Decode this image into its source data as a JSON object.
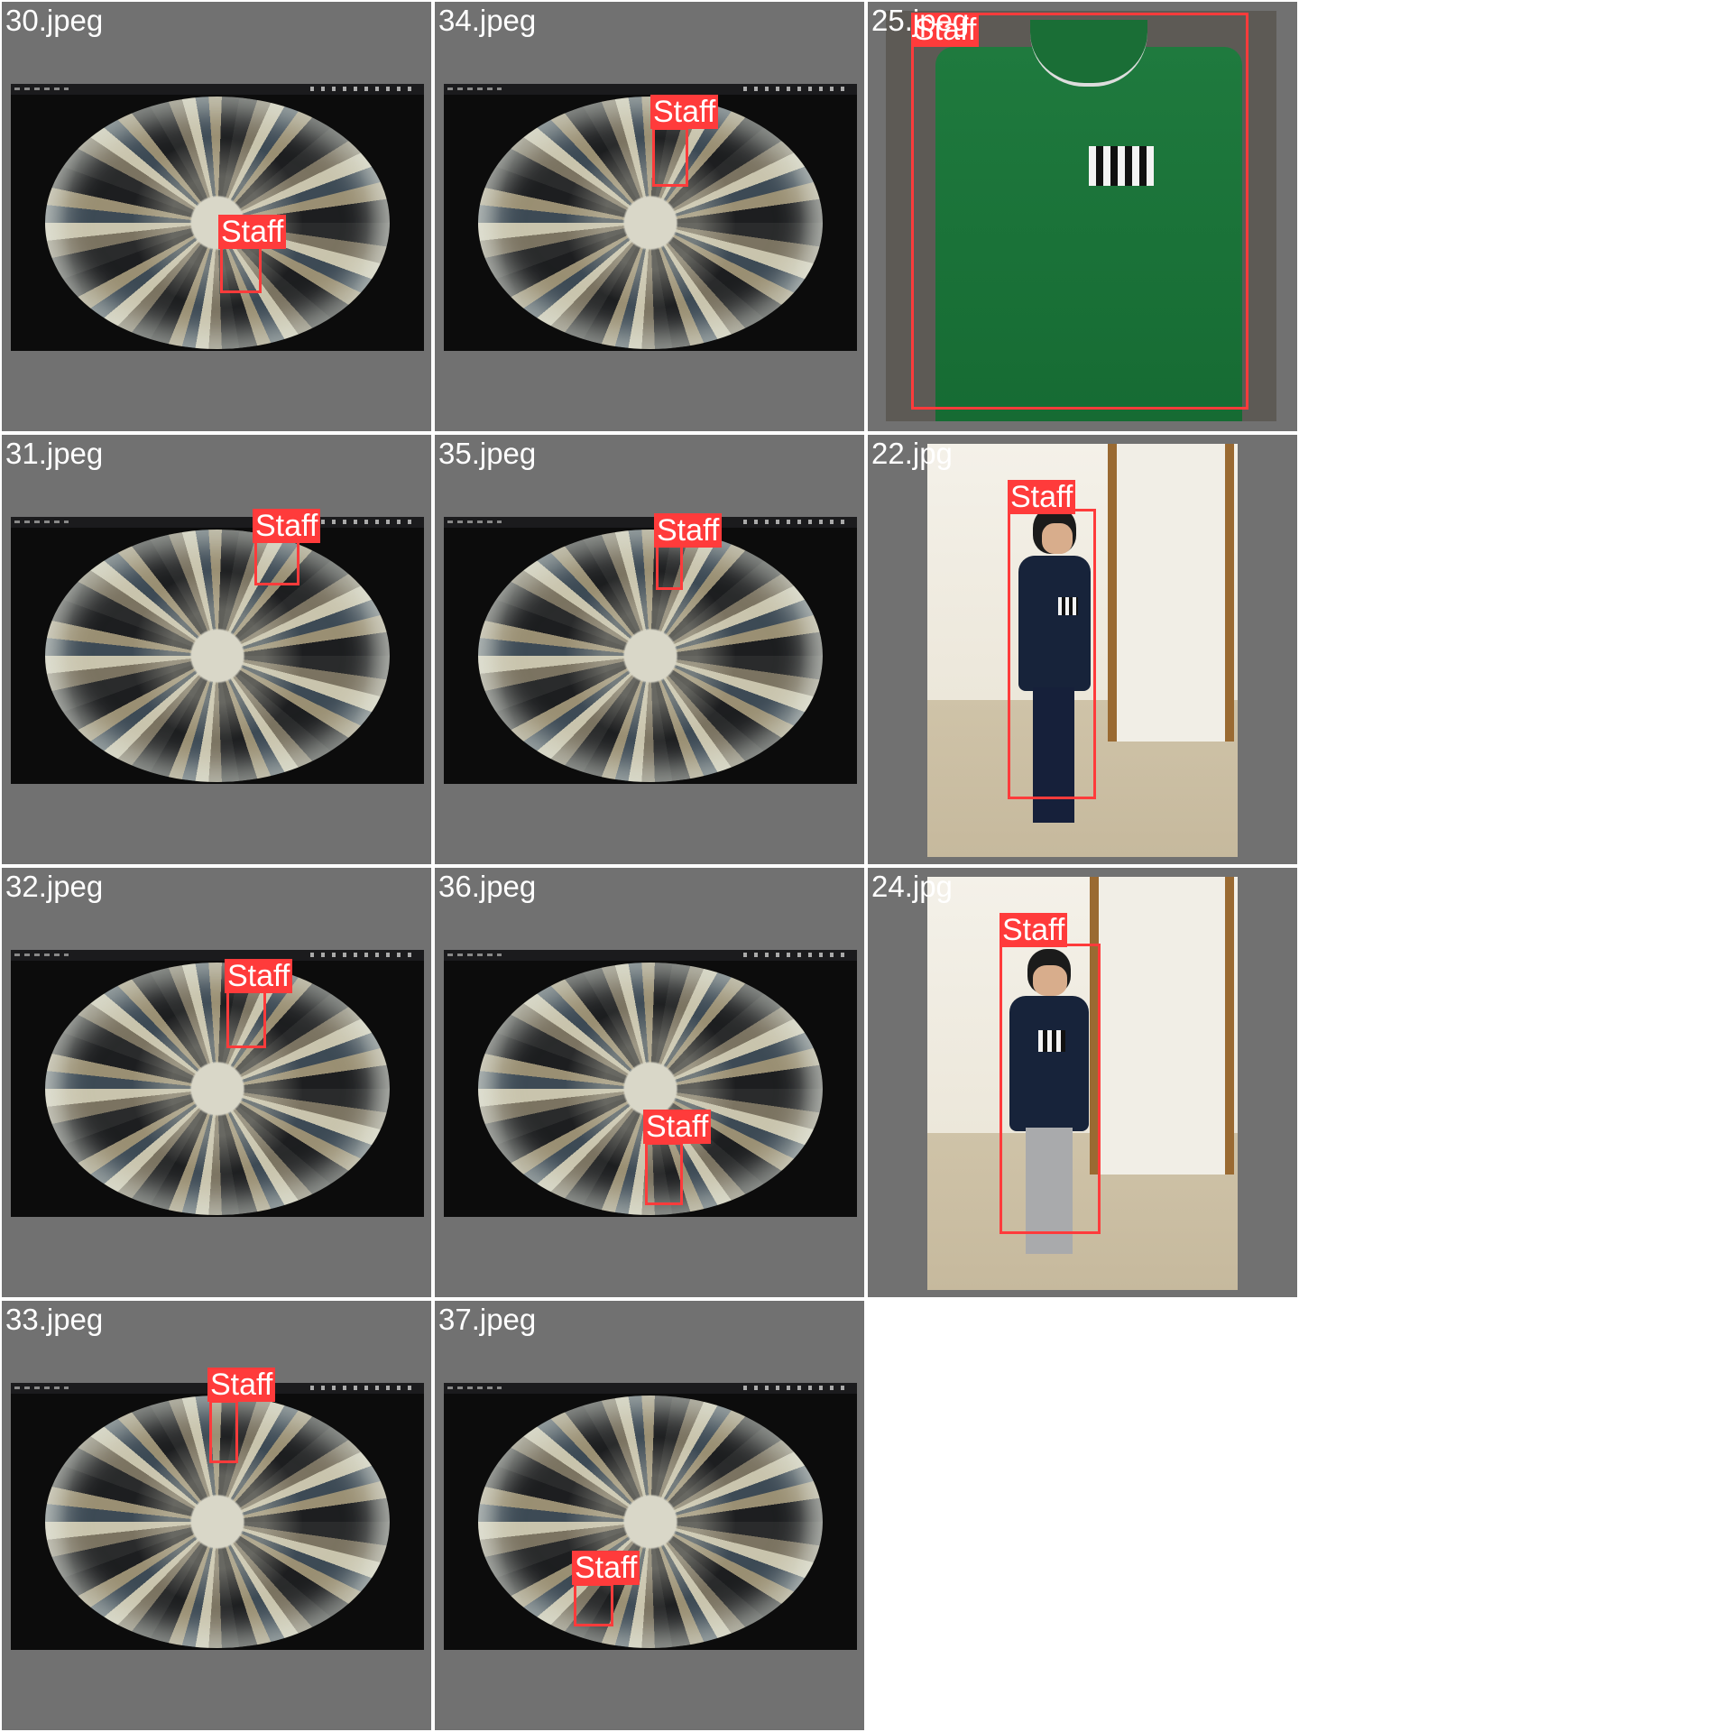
{
  "tiles": [
    {
      "filename": "30.jpeg",
      "detection_label": "Staff",
      "kind": "fisheye"
    },
    {
      "filename": "34.jpeg",
      "detection_label": "Staff",
      "kind": "fisheye"
    },
    {
      "filename": "25.jpeg",
      "detection_label": "Staff",
      "kind": "closeup"
    },
    {
      "filename": "31.jpeg",
      "detection_label": "Staff",
      "kind": "fisheye"
    },
    {
      "filename": "35.jpeg",
      "detection_label": "Staff",
      "kind": "fisheye"
    },
    {
      "filename": "22.jpg",
      "detection_label": "Staff",
      "kind": "fullbody"
    },
    {
      "filename": "32.jpeg",
      "detection_label": "Staff",
      "kind": "fisheye"
    },
    {
      "filename": "36.jpeg",
      "detection_label": "Staff",
      "kind": "fisheye"
    },
    {
      "filename": "24.jpg",
      "detection_label": "Staff",
      "kind": "fullbody"
    },
    {
      "filename": "33.jpeg",
      "detection_label": "Staff",
      "kind": "fisheye"
    },
    {
      "filename": "37.jpeg",
      "detection_label": "Staff",
      "kind": "fisheye"
    }
  ],
  "colors": {
    "tile_background": "#717171",
    "bbox": "#ff3b3b",
    "label_text": "#ffffff"
  }
}
